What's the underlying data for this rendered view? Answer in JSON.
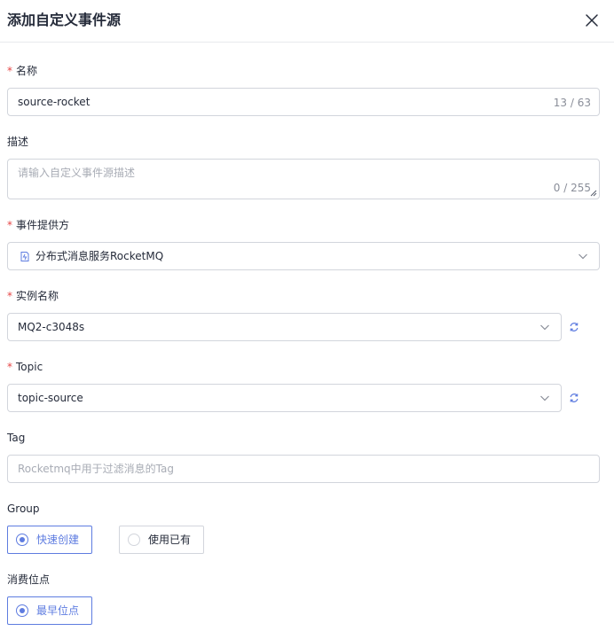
{
  "dialog": {
    "title": "添加自定义事件源",
    "close_icon": "close-icon"
  },
  "form": {
    "required_mark": "*",
    "name": {
      "label": "名称",
      "value": "source-rocket",
      "counter": "13 / 63"
    },
    "description": {
      "label": "描述",
      "placeholder": "请输入自定义事件源描述",
      "counter": "0 / 255"
    },
    "provider": {
      "label": "事件提供方",
      "value": "分布式消息服务RocketMQ",
      "icon": "rocketmq-service-icon"
    },
    "instance": {
      "label": "实例名称",
      "value": "MQ2-c3048s",
      "refresh_icon": "refresh-icon"
    },
    "topic": {
      "label": "Topic",
      "value": "topic-source",
      "refresh_icon": "refresh-icon"
    },
    "tag": {
      "label": "Tag",
      "placeholder": "Rocketmq中用于过滤消息的Tag"
    },
    "group": {
      "label": "Group",
      "options": [
        {
          "label": "快速创建",
          "selected": true
        },
        {
          "label": "使用已有",
          "selected": false
        }
      ]
    },
    "offset": {
      "label": "消费位点",
      "options": [
        {
          "label": "最早位点",
          "selected": true
        }
      ]
    }
  },
  "colors": {
    "accent": "#5e7ce0",
    "required": "#e54545",
    "border": "#d2d5dc",
    "placeholder": "#a8acb5"
  }
}
